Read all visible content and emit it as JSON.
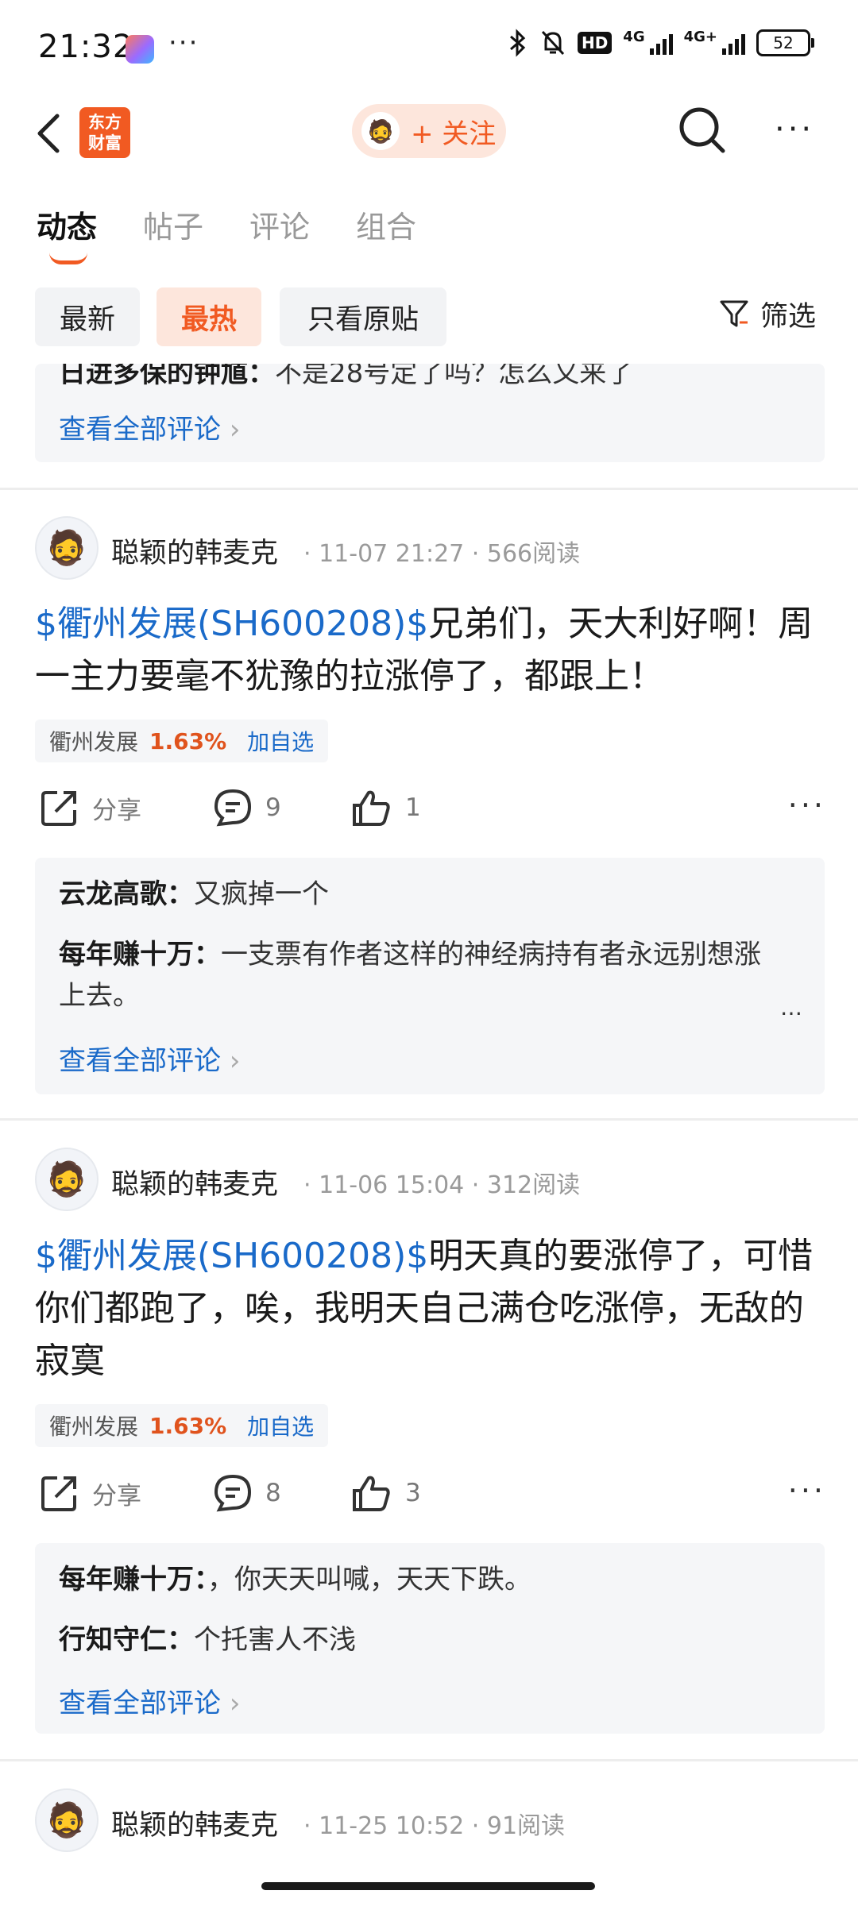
{
  "status_bar": {
    "time": "21:32",
    "dots": "···",
    "hd": "HD",
    "net1": "4G",
    "net2": "4G+",
    "battery": "52"
  },
  "header": {
    "logo_line1": "东方",
    "logo_line2": "财富",
    "follow_label": "+ 关注",
    "more": "···"
  },
  "tabs": [
    "动态",
    "帖子",
    "评论",
    "组合"
  ],
  "filters": {
    "chips": [
      "最新",
      "最热",
      "只看原贴"
    ],
    "filter_label": "筛选"
  },
  "top_box": {
    "partial_author": "日进多保的钟馗：",
    "partial_text": "不是28号定了吗？怎么又来了",
    "view_all": "查看全部评论"
  },
  "posts": [
    {
      "author": "聪颖的韩麦克",
      "date": "11-07 21:27",
      "reads": "566阅读",
      "tag": "$衢州发展(SH600208)$",
      "text": "兄弟们，天大利好啊！周一主力要毫不犹豫的拉涨停了，都跟上！",
      "stock_name": "衢州发展",
      "stock_pct": "1.63%",
      "add_label": "加自选",
      "share": "分享",
      "comments": "9",
      "likes": "1",
      "replies": [
        {
          "author": "云龙高歌：",
          "text": "又疯掉一个"
        },
        {
          "author": "每年赚十万：",
          "text": "一支票有作者这样的神经病持有者永远别想涨上去。"
        }
      ],
      "view_all": "查看全部评论"
    },
    {
      "author": "聪颖的韩麦克",
      "date": "11-06 15:04",
      "reads": "312阅读",
      "tag": "$衢州发展(SH600208)$",
      "text": "明天真的要涨停了，可惜你们都跑了，唉，我明天自己满仓吃涨停，无敌的寂寞",
      "stock_name": "衢州发展",
      "stock_pct": "1.63%",
      "add_label": "加自选",
      "share": "分享",
      "comments": "8",
      "likes": "3",
      "replies": [
        {
          "author": "每年赚十万：",
          "text": "，你天天叫喊，天天下跌。"
        },
        {
          "author": "行知守仁：",
          "text": "个托害人不浅"
        }
      ],
      "view_all": "查看全部评论"
    },
    {
      "author": "聪颖的韩麦克",
      "date": "11-25 10:52",
      "reads": "91阅读"
    }
  ]
}
